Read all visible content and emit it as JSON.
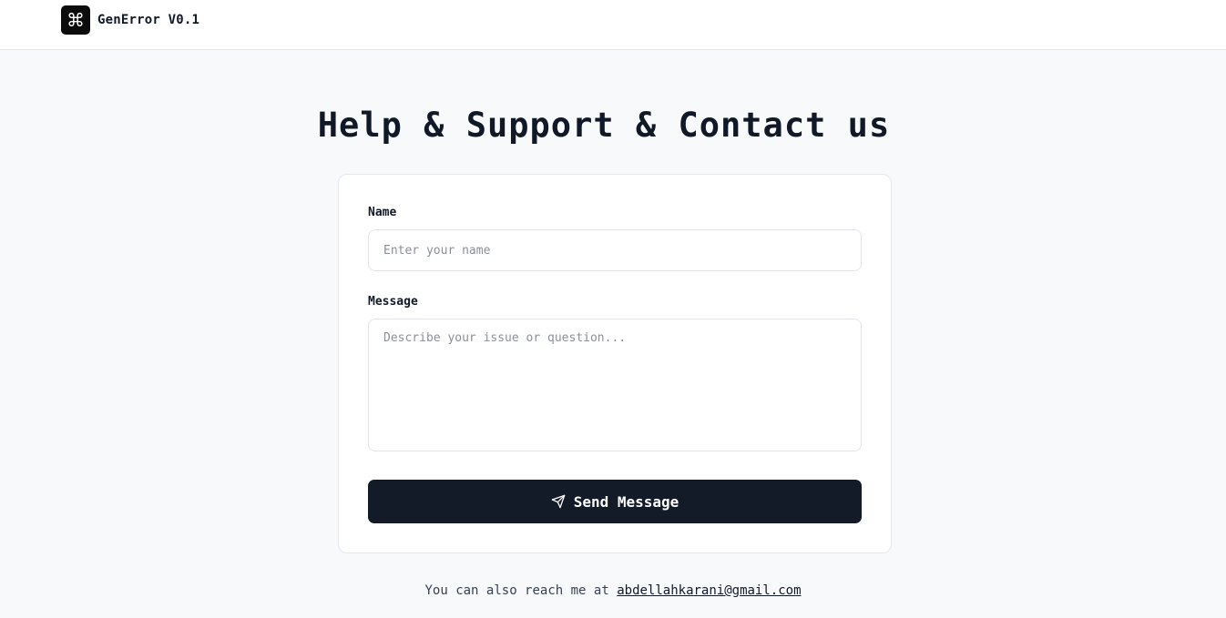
{
  "header": {
    "logo_glyph": "⌘",
    "brand": "GenError V0.1"
  },
  "page": {
    "title": "Help & Support & Contact us"
  },
  "form": {
    "name_label": "Name",
    "name_placeholder": "Enter your name",
    "name_value": "",
    "message_label": "Message",
    "message_placeholder": "Describe your issue or question...",
    "message_value": "",
    "submit_label": "Send Message",
    "submit_icon": "send-icon"
  },
  "footer": {
    "text": "You can also reach me at",
    "email": "abdellahkarani@gmail.com"
  },
  "colors": {
    "background": "#f8f9fb",
    "button": "#131a28",
    "text": "#111827"
  }
}
